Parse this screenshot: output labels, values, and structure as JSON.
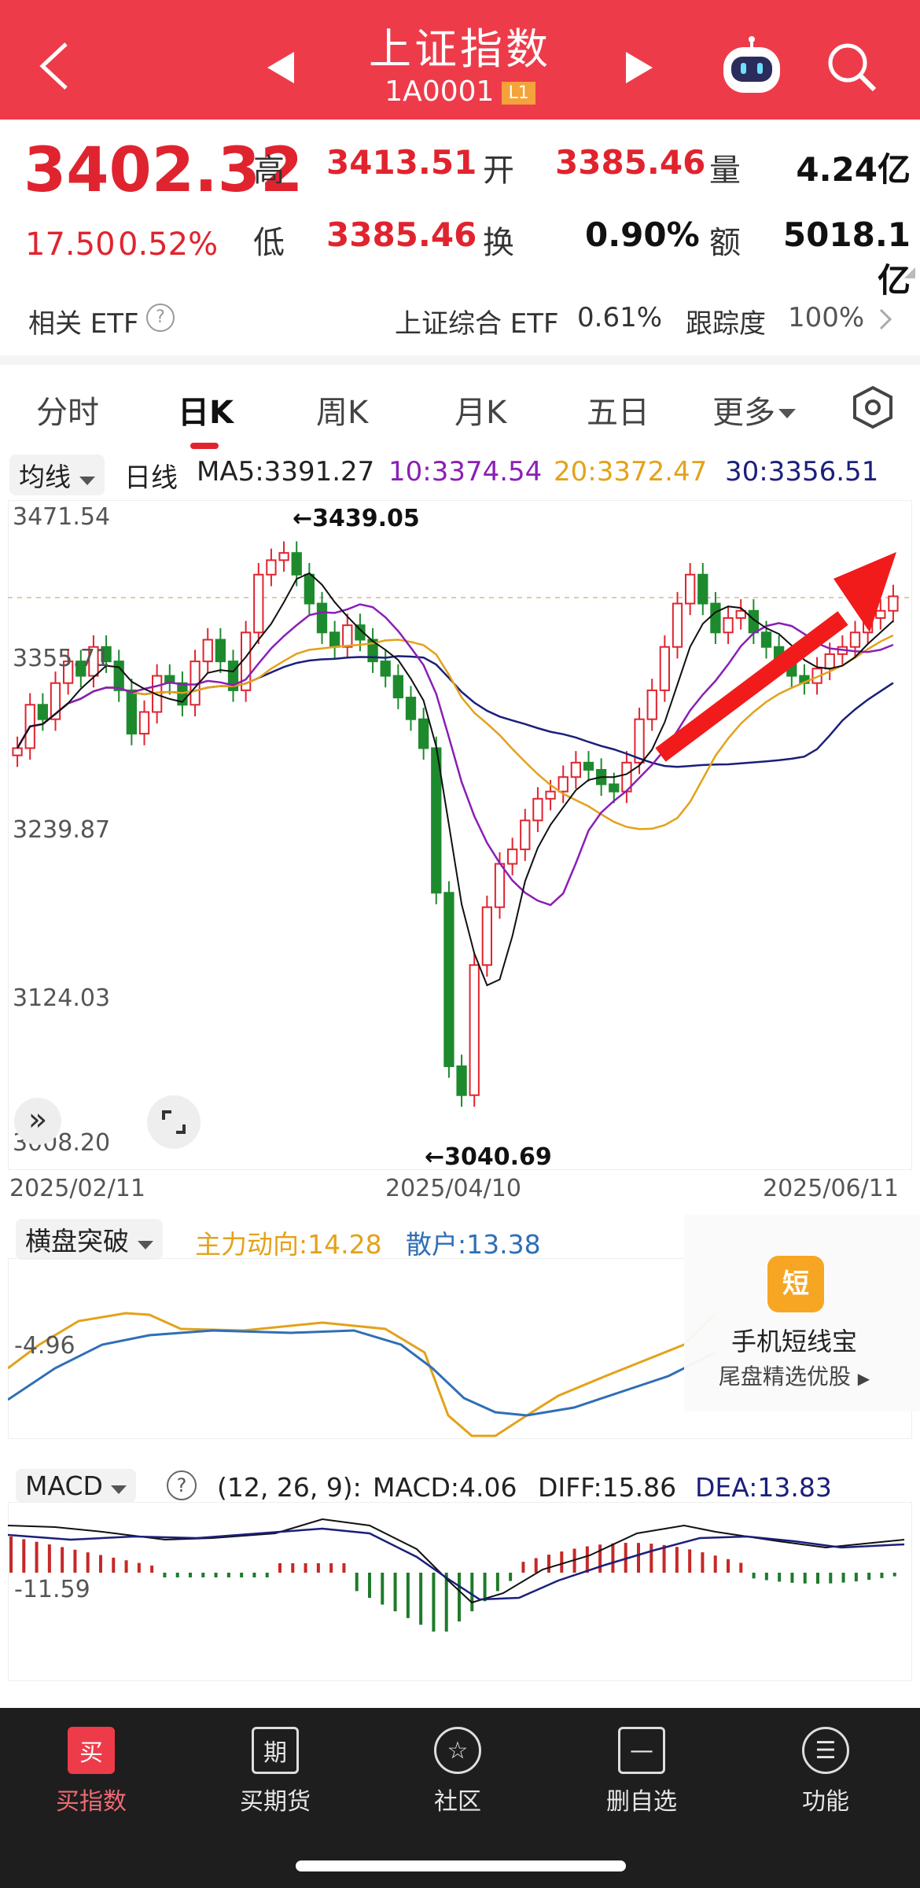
{
  "header": {
    "title": "上证指数",
    "code": "1A0001",
    "level_badge": "L1",
    "back_icon": "back-arrow-icon",
    "prev_icon": "prev-triangle-icon",
    "next_icon": "next-triangle-icon",
    "robot_icon": "robot-assistant-icon",
    "search_icon": "search-icon"
  },
  "quote": {
    "price": "3402.32",
    "change": "17.50",
    "change_pct": "0.52%",
    "labels": {
      "high": "高",
      "open": "开",
      "volume": "量",
      "low": "低",
      "turnover_rate": "换",
      "amount": "额"
    },
    "high": "3413.51",
    "open": "3385.46",
    "volume": "4.24亿",
    "low": "3385.46",
    "turnover_rate": "0.90%",
    "amount": "5018.1亿"
  },
  "etf": {
    "label": "相关 ETF",
    "name": "上证综合 ETF",
    "pct": "0.61%",
    "track_label": "跟踪度",
    "track_value": "100%"
  },
  "tabs": [
    "分时",
    "日K",
    "周K",
    "月K",
    "五日",
    "更多"
  ],
  "active_tab": "日K",
  "ma": {
    "selector": "均线",
    "period": "日线",
    "ma5": "MA5:3391.27",
    "ma10": "10:3374.54",
    "ma20": "20:3372.47",
    "ma30": "30:3356.51"
  },
  "main_chart": {
    "y_labels": [
      "3471.54",
      "3355.71",
      "3239.87",
      "3124.03",
      "3008.20"
    ],
    "x_labels": [
      "2025/02/11",
      "2025/04/10",
      "2025/06/11"
    ],
    "high_marker": "←3439.05",
    "low_marker": "←3040.69",
    "trend_arrow_color": "#f21b1b"
  },
  "indicator1": {
    "name": "横盘突破",
    "main_force": "主力动向:14.28",
    "retail": "散户:13.38",
    "y_label": "-4.96",
    "colors": {
      "main_force": "#e3a21a",
      "retail": "#2f6fb5"
    }
  },
  "macd": {
    "name": "MACD",
    "help": "?",
    "params": "(12, 26, 9):",
    "macd": "MACD:4.06",
    "diff": "DIFF:15.86",
    "dea": "DEA:13.83",
    "y_label": "-11.59"
  },
  "promo": {
    "icon_text": "短",
    "title": "手机短线宝",
    "subtitle": "尾盘精选优股"
  },
  "nav": [
    {
      "icon": "买",
      "label": "买指数"
    },
    {
      "icon": "期",
      "label": "买期货"
    },
    {
      "icon": "☆",
      "label": "社区"
    },
    {
      "icon": "—",
      "label": "删自选"
    },
    {
      "icon": "☰",
      "label": "功能"
    }
  ],
  "colors": {
    "header_bg": "#ee3b4a",
    "up": "#e0242f",
    "down": "#1e8a2e",
    "ma5": "#111111",
    "ma10": "#8a1fb5",
    "ma20": "#e3a21a",
    "ma30": "#1b1f7a"
  }
}
